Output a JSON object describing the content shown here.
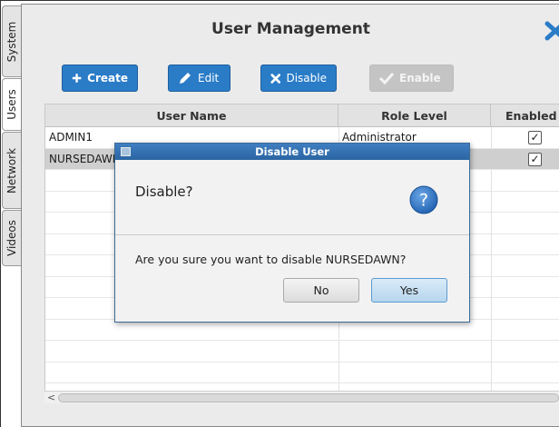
{
  "tabs": [
    {
      "label": "System",
      "active": false
    },
    {
      "label": "Users",
      "active": true
    },
    {
      "label": "Network",
      "active": false
    },
    {
      "label": "Videos",
      "active": false
    }
  ],
  "header": {
    "title": "User Management",
    "close_icon": "close-x-icon"
  },
  "toolbar": {
    "create_label": "Create",
    "edit_label": "Edit",
    "disable_label": "Disable",
    "enable_label": "Enable"
  },
  "table": {
    "columns": [
      "User Name",
      "Role Level",
      "Enabled"
    ],
    "rows": [
      {
        "user_name": "ADMIN1",
        "role_level": "Administrator",
        "enabled": true
      },
      {
        "user_name": "NURSEDAWN",
        "role_level": "",
        "enabled": true
      }
    ]
  },
  "dialog": {
    "title": "Disable User",
    "header_text": "Disable?",
    "message": "Are you sure you want to disable NURSEDAWN?",
    "no_label": "No",
    "yes_label": "Yes",
    "icon": "question-icon"
  },
  "colors": {
    "accent": "#2a7cc7",
    "dialog_title": "#2f6aab",
    "selected_row": "#cfcfcf"
  }
}
